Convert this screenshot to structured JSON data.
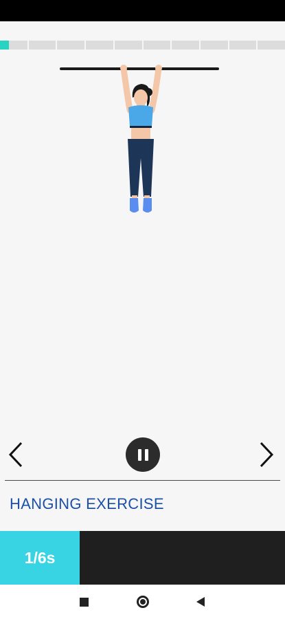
{
  "workout": {
    "exercise_name": "HANGING EXERCISE",
    "timer_label": "1/6s",
    "timer_progress": 0.28,
    "step_progress": {
      "total_steps": 10,
      "current_step": 1,
      "current_fraction": 0.33
    }
  },
  "icons": {
    "previous": "chevron-left-icon",
    "next": "chevron-right-icon",
    "pause": "pause-icon",
    "recents": "recents-icon",
    "home": "home-icon",
    "back": "back-icon"
  },
  "colors": {
    "progress_active": "#29d3c3",
    "progress_inactive": "#dcdcdc",
    "timer_fill": "#38d4e3",
    "title": "#1b4fa8",
    "top_color": "#4aa8e8",
    "pants_color": "#1d3557",
    "shoes_color": "#5a8df0"
  }
}
